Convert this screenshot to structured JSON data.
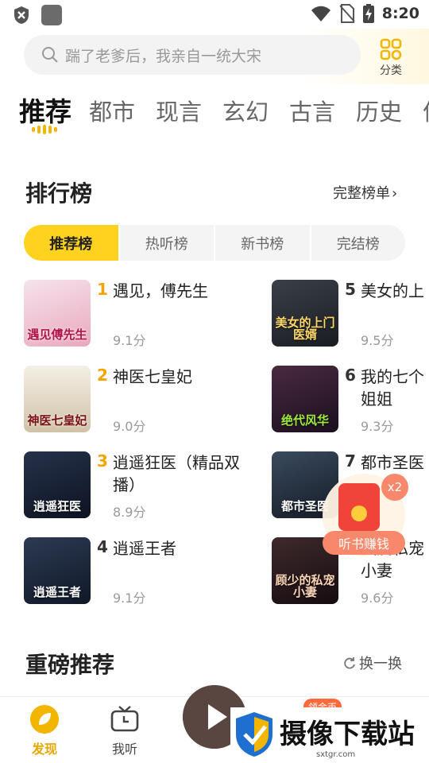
{
  "status_bar": {
    "time": "8:20",
    "icons": [
      "shield-x-icon",
      "app-square-icon",
      "wifi-icon",
      "no-sim-icon",
      "battery-charging-icon"
    ]
  },
  "search": {
    "placeholder": "踹了老爹后，我亲自一统大宋"
  },
  "category_button": {
    "label": "分类",
    "icon": "grid-icon"
  },
  "tabs": [
    "推荐",
    "都市",
    "现言",
    "玄幻",
    "古言",
    "历史",
    "仙"
  ],
  "active_tab": "推荐",
  "ranking": {
    "title": "排行榜",
    "see_all": "完整榜单",
    "subtabs": [
      "推荐榜",
      "热听榜",
      "新书榜",
      "完结榜"
    ],
    "active_subtab": "推荐榜",
    "books": [
      {
        "rank": "1",
        "title": "遇见，傅先生",
        "score": "9.1分",
        "cover_text": "遇见傅先生"
      },
      {
        "rank": "2",
        "title": "神医七皇妃",
        "score": "9.0分",
        "cover_text": "神医七皇妃"
      },
      {
        "rank": "3",
        "title": "逍遥狂医（精品双播）",
        "score": "8.9分",
        "cover_text": "逍遥狂医"
      },
      {
        "rank": "4",
        "title": "逍遥王者",
        "score": "9.1分",
        "cover_text": "逍遥王者"
      },
      {
        "rank": "5",
        "title": "美女的上",
        "score": "9.5分",
        "cover_text": "美女的上门医婿"
      },
      {
        "rank": "6",
        "title": "我的七个姐姐",
        "score": "9.3分",
        "cover_text": "绝代风华"
      },
      {
        "rank": "7",
        "title": "都市圣医",
        "score": "",
        "cover_text": "都市圣医"
      },
      {
        "rank": "",
        "title": "独爱私宠小妻",
        "score": "9.6分",
        "cover_text": "顾少的私宠小妻"
      }
    ],
    "rank_colors": [
      "#f2a400",
      "#f2a400",
      "#f2a400",
      "#333333",
      "#333333",
      "#333333",
      "#333333",
      "#333333"
    ]
  },
  "reward_float": {
    "badge": "x2",
    "label": "听书赚钱"
  },
  "featured": {
    "title": "重磅推荐",
    "refresh": "换一换"
  },
  "bottom_nav": {
    "items": [
      {
        "label": "发现",
        "icon": "leaf-icon",
        "active": true
      },
      {
        "label": "我听",
        "icon": "tv-icon",
        "active": false
      }
    ],
    "coin_badge": "领金币"
  },
  "watermark": {
    "text": "摄像下载站",
    "url": "sxtgr.com"
  },
  "colors": {
    "accent": "#ffd21f",
    "accent_text": "#e5a800",
    "reward": "#f7886b"
  }
}
